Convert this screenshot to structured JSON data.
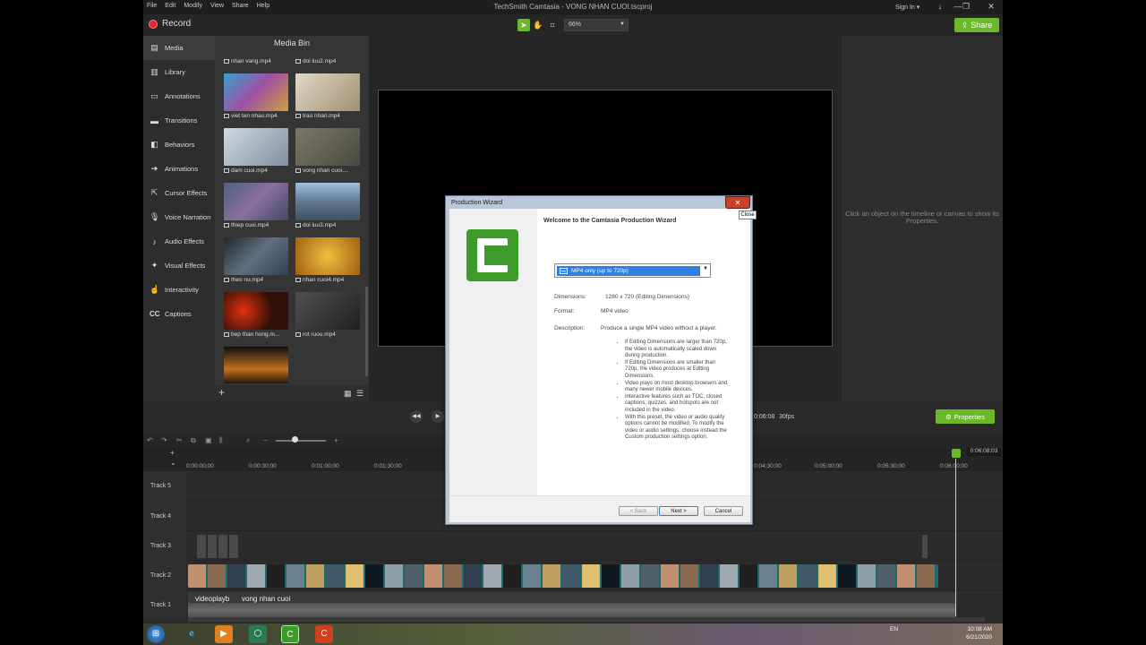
{
  "window": {
    "title": "TechSmith Camtasia - VONG NHAN CUOI.tscproj",
    "menu": [
      "File",
      "Edit",
      "Modify",
      "View",
      "Share",
      "Help"
    ],
    "sign_in": "Sign In ▾",
    "controls": [
      "↓",
      "—",
      "❐",
      "✕"
    ]
  },
  "toolbar": {
    "record_label": "Record",
    "zoom_value": "66%",
    "share_label": "Share"
  },
  "sidebar": {
    "items": [
      {
        "label": "Media",
        "icon": "media-icon"
      },
      {
        "label": "Library",
        "icon": "library-icon"
      },
      {
        "label": "Annotations",
        "icon": "annotations-icon"
      },
      {
        "label": "Transitions",
        "icon": "transitions-icon"
      },
      {
        "label": "Behaviors",
        "icon": "behaviors-icon"
      },
      {
        "label": "Animations",
        "icon": "animations-icon"
      },
      {
        "label": "Cursor Effects",
        "icon": "cursor-icon"
      },
      {
        "label": "Voice Narration",
        "icon": "microphone-icon"
      },
      {
        "label": "Audio Effects",
        "icon": "audio-icon"
      },
      {
        "label": "Visual Effects",
        "icon": "visual-effects-icon"
      },
      {
        "label": "Interactivity",
        "icon": "interactivity-icon"
      },
      {
        "label": "Captions",
        "icon": "cc-icon"
      }
    ]
  },
  "media_bin": {
    "title": "Media Bin",
    "items": [
      {
        "label": "nhan vang.mp4",
        "color": "#6a5a3a"
      },
      {
        "label": "doi luu2.mp4",
        "color": "#8a8070"
      },
      {
        "label": "viet ten nhau.mp4",
        "color": "#4a7aa0"
      },
      {
        "label": "trao nhan.mp4",
        "color": "#c0b8a8"
      },
      {
        "label": "dam cuoi.mp4",
        "color": "#a8b0b8"
      },
      {
        "label": "vong nhan cuoi....",
        "color": "#606058"
      },
      {
        "label": "thiep cuoi.mp4",
        "color": "#5a6070"
      },
      {
        "label": "doi luu3.mp4",
        "color": "#8aa0b8"
      },
      {
        "label": "theo nu.mp4",
        "color": "#3a4a5a"
      },
      {
        "label": "nhan cuoi4.mp4",
        "color": "#c89030"
      },
      {
        "label": "bep than hong.m...",
        "color": "#4a1a10"
      },
      {
        "label": "rot ruou.mp4",
        "color": "#3a3a3a"
      },
      {
        "label": "",
        "color": "#3a2a10"
      }
    ]
  },
  "properties_hint": "Click an object on the timeline or canvas to show its Properties.",
  "playback": {
    "time": "0:06:08",
    "fps": "30fps",
    "properties_label": "Properties"
  },
  "timeline": {
    "ruler": [
      "0:00:00;00",
      "0:00:30;00",
      "0:01:00;00",
      "0:01:30;00",
      "0:04:30;00",
      "0:05:00;00",
      "0:05:30;00",
      "0:06:00;00"
    ],
    "playhead_time": "0:06:08;03",
    "tracks": [
      "Track 5",
      "Track 4",
      "Track 3",
      "Track 2",
      "Track 1"
    ],
    "audio_labels": [
      "videoplayb",
      "vong nhan cuoi"
    ]
  },
  "dialog": {
    "title": "Production Wizard",
    "close_tooltip": "Close",
    "heading": "Welcome to the Camtasia Production Wizard",
    "preset": "MP4 only (up to 720p)",
    "dimensions_label": "Dimensions:",
    "dimensions_value": "1280 x 720 (Editing Dimensions)",
    "format_label": "Format:",
    "format_value": "MP4 video",
    "description_label": "Description:",
    "description_value": "Produce a single MP4 video without a player.",
    "bullets": [
      "If Editing Dimensions are larger than 720p, the video is automatically scaled down during production.",
      "If Editing Dimensions are smaller than 720p, the video produces at Editing Dimensions.",
      "Video plays on most desktop browsers and many newer mobile devices.",
      "Interactive features such as TOC, closed captions, quizzes, and hotspots are not included in the video.",
      "With this preset, the video or audio quality options cannot be modified. To modify the video or audio settings, choose instead the Custom production settings option."
    ],
    "back_label": "< Back",
    "next_label": "Next >",
    "cancel_label": "Cancel"
  },
  "taskbar": {
    "lang": "EN",
    "time": "10:08 AM",
    "date": "6/21/2020"
  }
}
